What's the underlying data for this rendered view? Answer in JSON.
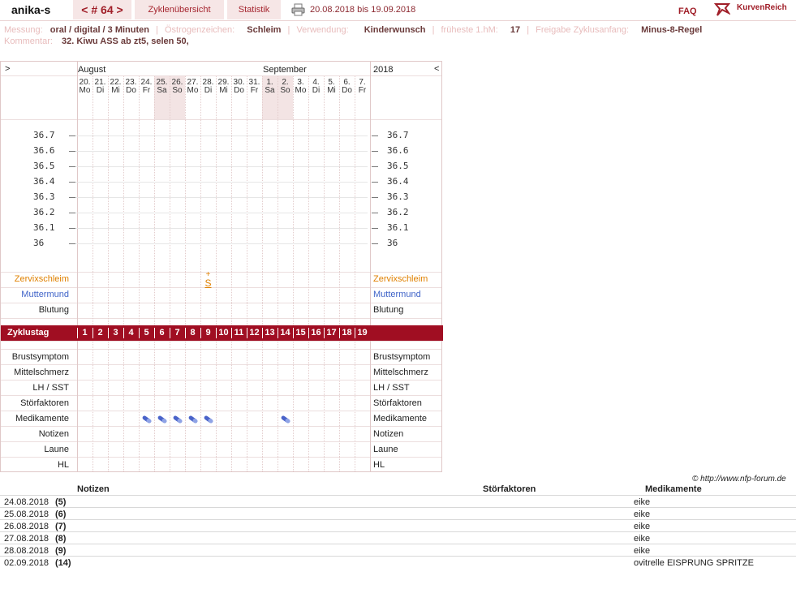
{
  "header": {
    "user": "anika-s",
    "cycle_nav": "< # 64 >",
    "tab_overview": "Zyklenübersicht",
    "tab_stats": "Statistik",
    "date_range": "20.08.2018 bis 19.09.2018",
    "faq": "FAQ",
    "brand": "KurvenReich"
  },
  "meta": {
    "messung_label": "Messung:",
    "messung_value": "oral / digital / 3 Minuten",
    "oestrogen_label": "Östrogenzeichen:",
    "oestrogen_value": "Schleim",
    "verwendung_label": "Verwendung:",
    "verwendung_value": "Kinderwunsch",
    "hm_label": "früheste 1.hM:",
    "hm_value": "17",
    "freigabe_label": "Freigabe Zyklusanfang:",
    "freigabe_value": "Minus-8-Regel",
    "kommentar_label": "Kommentar:",
    "kommentar_value": "32. Kiwu ASS ab zt5, selen 50,"
  },
  "chart": {
    "nav_prev": ">",
    "nav_next": "<",
    "month1": "August",
    "month2": "September",
    "year": "2018",
    "days": [
      {
        "d": "20.",
        "w": "Mo",
        "we": false
      },
      {
        "d": "21.",
        "w": "Di",
        "we": false
      },
      {
        "d": "22.",
        "w": "Mi",
        "we": false
      },
      {
        "d": "23.",
        "w": "Do",
        "we": false
      },
      {
        "d": "24.",
        "w": "Fr",
        "we": false
      },
      {
        "d": "25.",
        "w": "Sa",
        "we": true
      },
      {
        "d": "26.",
        "w": "So",
        "we": true
      },
      {
        "d": "27.",
        "w": "Mo",
        "we": false
      },
      {
        "d": "28.",
        "w": "Di",
        "we": false
      },
      {
        "d": "29.",
        "w": "Mi",
        "we": false
      },
      {
        "d": "30.",
        "w": "Do",
        "we": false
      },
      {
        "d": "31.",
        "w": "Fr",
        "we": false
      },
      {
        "d": "1.",
        "w": "Sa",
        "we": true
      },
      {
        "d": "2.",
        "w": "So",
        "we": true
      },
      {
        "d": "3.",
        "w": "Mo",
        "we": false
      },
      {
        "d": "4.",
        "w": "Di",
        "we": false
      },
      {
        "d": "5.",
        "w": "Mi",
        "we": false
      },
      {
        "d": "6.",
        "w": "Do",
        "we": false
      },
      {
        "d": "7.",
        "w": "Fr",
        "we": false
      }
    ],
    "temps": [
      "36.7",
      "36.6",
      "36.5",
      "36.4",
      "36.3",
      "36.2",
      "36.1",
      "36"
    ],
    "zervix_label": "Zervixschleim",
    "zervix_symbol": "S",
    "zervix_day": 9,
    "muttermund_label": "Muttermund",
    "blutung_label": "Blutung",
    "zyklustag_label": "Zyklustag",
    "zyklustage": [
      "1",
      "2",
      "3",
      "4",
      "5",
      "6",
      "7",
      "8",
      "9",
      "10",
      "11",
      "12",
      "13",
      "14",
      "15",
      "16",
      "17",
      "18",
      "19"
    ],
    "rows": [
      "Brustsymptom",
      "Mittelschmerz",
      "LH / SST",
      "Störfaktoren",
      "Medikamente",
      "Notizen",
      "Laune",
      "HL"
    ],
    "medikamente_days": [
      5,
      6,
      7,
      8,
      9,
      14
    ],
    "colors": {
      "zervix": "#e08000",
      "muttermund": "#3f63c8",
      "zyklus": "#a00e22",
      "pill": "#4a63c9"
    }
  },
  "copyright": "© http://www.nfp-forum.de",
  "notes": {
    "headers": {
      "notizen": "Notizen",
      "stoerfaktoren": "Störfaktoren",
      "medikamente": "Medikamente"
    },
    "rows": [
      {
        "date": "24.08.2018",
        "zt": "(5)",
        "med": "eike"
      },
      {
        "date": "25.08.2018",
        "zt": "(6)",
        "med": "eike"
      },
      {
        "date": "26.08.2018",
        "zt": "(7)",
        "med": "eike"
      },
      {
        "date": "27.08.2018",
        "zt": "(8)",
        "med": "eike"
      },
      {
        "date": "28.08.2018",
        "zt": "(9)",
        "med": "eike"
      },
      {
        "date": "02.09.2018",
        "zt": "(14)",
        "med": "ovitrelle EISPRUNG SPRITZE"
      }
    ]
  }
}
